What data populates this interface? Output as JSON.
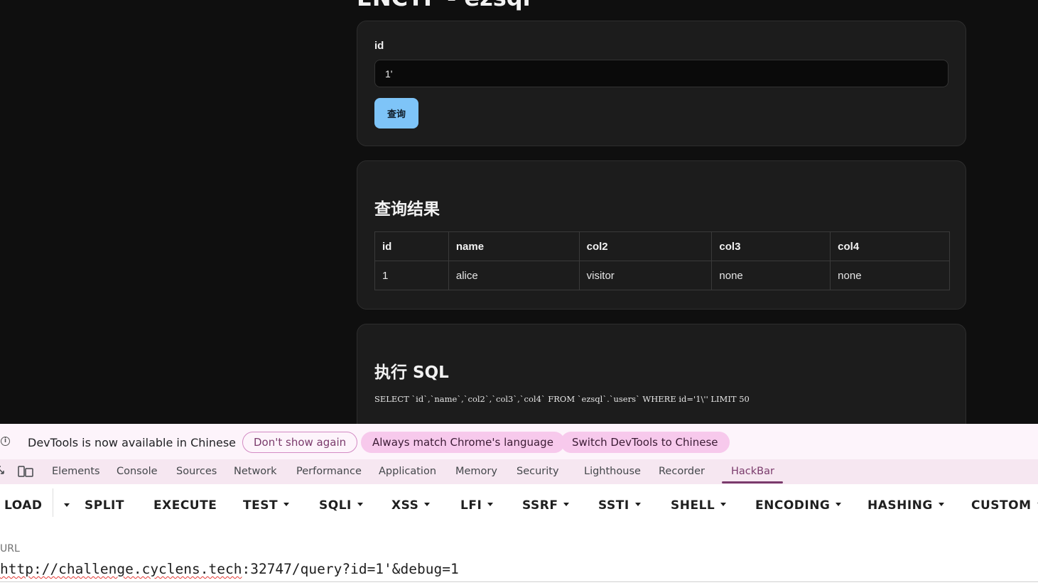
{
  "page": {
    "title": "ENCTF - ezsql"
  },
  "form": {
    "label": "id",
    "input_value": "1'",
    "submit_label": "查询"
  },
  "results": {
    "title": "查询结果",
    "columns": [
      "id",
      "name",
      "col2",
      "col3",
      "col4"
    ],
    "rows": [
      [
        "1",
        "alice",
        "visitor",
        "none",
        "none"
      ]
    ]
  },
  "sql": {
    "title": "执行 SQL",
    "statement": "SELECT `id`,`name`,`col2`,`col3`,`col4` FROM `ezsql`.`users` WHERE id='1\\'' LIMIT 50"
  },
  "devtools": {
    "lang_banner": {
      "message": "DevTools is now available in Chinese",
      "dont_show": "Don't show again",
      "always_match": "Always match Chrome's language",
      "switch": "Switch DevTools to Chinese"
    },
    "tabs": [
      "Elements",
      "Console",
      "Sources",
      "Network",
      "Performance",
      "Application",
      "Memory",
      "Security",
      "Lighthouse",
      "Recorder",
      "HackBar"
    ],
    "active_tab": "HackBar"
  },
  "hackbar": {
    "menu": [
      "LOAD",
      "SPLIT",
      "EXECUTE",
      "TEST",
      "SQLI",
      "XSS",
      "LFI",
      "SSRF",
      "SSTI",
      "SHELL",
      "ENCODING",
      "HASHING",
      "CUSTOM"
    ],
    "url_label": "URL",
    "url_misspelled_part": "http://challenge.cyclens.tech",
    "url_rest": ":32747/query?id=1'&debug=1"
  },
  "colors": {
    "page_bg": "#0f0f0f",
    "card_bg": "#1c1c1c",
    "button_bg": "#7ec4f8",
    "devtools_accent": "#7a3b6c",
    "banner_pill": "#f7c9ec"
  }
}
